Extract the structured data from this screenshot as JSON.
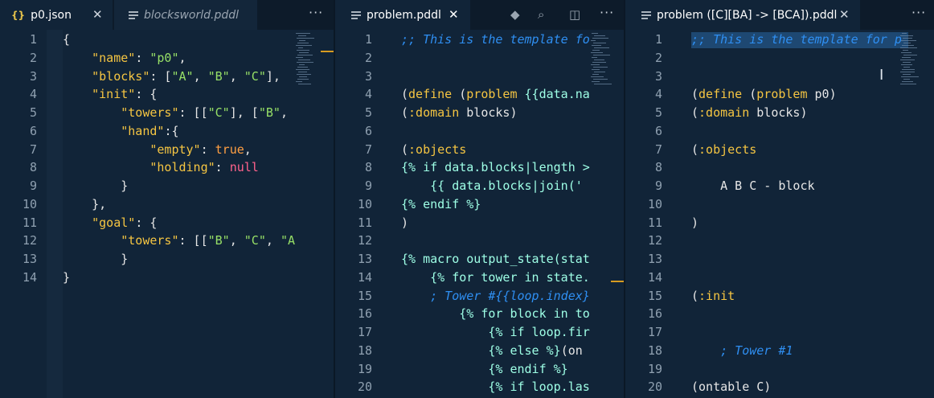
{
  "pane1": {
    "tabs": [
      {
        "label": "p0.json",
        "icon": "json-file-icon",
        "close": "✕"
      },
      {
        "label": "blocksworld.pddl",
        "icon": "lines-file-icon"
      }
    ],
    "more": "···",
    "lines": [
      {
        "n": "1",
        "segs": [
          {
            "t": "{",
            "c": "p"
          }
        ]
      },
      {
        "n": "2",
        "segs": [
          {
            "t": "    ",
            "c": "p"
          },
          {
            "t": "\"name\"",
            "c": "k"
          },
          {
            "t": ": ",
            "c": "p"
          },
          {
            "t": "\"p0\"",
            "c": "s"
          },
          {
            "t": ",",
            "c": "p"
          }
        ]
      },
      {
        "n": "3",
        "segs": [
          {
            "t": "    ",
            "c": "p"
          },
          {
            "t": "\"blocks\"",
            "c": "k"
          },
          {
            "t": ": [",
            "c": "p"
          },
          {
            "t": "\"A\"",
            "c": "s"
          },
          {
            "t": ", ",
            "c": "p"
          },
          {
            "t": "\"B\"",
            "c": "s"
          },
          {
            "t": ", ",
            "c": "p"
          },
          {
            "t": "\"C\"",
            "c": "s"
          },
          {
            "t": "],",
            "c": "p"
          }
        ]
      },
      {
        "n": "4",
        "segs": [
          {
            "t": "    ",
            "c": "p"
          },
          {
            "t": "\"init\"",
            "c": "k"
          },
          {
            "t": ": {",
            "c": "p"
          }
        ]
      },
      {
        "n": "5",
        "segs": [
          {
            "t": "        ",
            "c": "p"
          },
          {
            "t": "\"towers\"",
            "c": "k"
          },
          {
            "t": ": [[",
            "c": "p"
          },
          {
            "t": "\"C\"",
            "c": "s"
          },
          {
            "t": "], [",
            "c": "p"
          },
          {
            "t": "\"B\"",
            "c": "s"
          },
          {
            "t": ",",
            "c": "p"
          }
        ]
      },
      {
        "n": "6",
        "segs": [
          {
            "t": "        ",
            "c": "p"
          },
          {
            "t": "\"hand\"",
            "c": "k"
          },
          {
            "t": ":{",
            "c": "p"
          }
        ]
      },
      {
        "n": "7",
        "segs": [
          {
            "t": "            ",
            "c": "p"
          },
          {
            "t": "\"empty\"",
            "c": "k"
          },
          {
            "t": ": ",
            "c": "p"
          },
          {
            "t": "true",
            "c": "b"
          },
          {
            "t": ",",
            "c": "p"
          }
        ]
      },
      {
        "n": "8",
        "segs": [
          {
            "t": "            ",
            "c": "p"
          },
          {
            "t": "\"holding\"",
            "c": "k"
          },
          {
            "t": ": ",
            "c": "p"
          },
          {
            "t": "null",
            "c": "n"
          }
        ]
      },
      {
        "n": "9",
        "segs": [
          {
            "t": "        }",
            "c": "p"
          }
        ]
      },
      {
        "n": "10",
        "segs": [
          {
            "t": "    },",
            "c": "p"
          }
        ]
      },
      {
        "n": "11",
        "segs": [
          {
            "t": "    ",
            "c": "p"
          },
          {
            "t": "\"goal\"",
            "c": "k"
          },
          {
            "t": ": {",
            "c": "p"
          }
        ]
      },
      {
        "n": "12",
        "segs": [
          {
            "t": "        ",
            "c": "p"
          },
          {
            "t": "\"towers\"",
            "c": "k"
          },
          {
            "t": ": [[",
            "c": "p"
          },
          {
            "t": "\"B\"",
            "c": "s"
          },
          {
            "t": ", ",
            "c": "p"
          },
          {
            "t": "\"C\"",
            "c": "s"
          },
          {
            "t": ", ",
            "c": "p"
          },
          {
            "t": "\"A",
            "c": "s"
          }
        ]
      },
      {
        "n": "13",
        "segs": [
          {
            "t": "        }",
            "c": "p"
          }
        ]
      },
      {
        "n": "14",
        "segs": [
          {
            "t": "}",
            "c": "p"
          }
        ]
      }
    ]
  },
  "pane2": {
    "tabs": [
      {
        "label": "problem.pddl",
        "icon": "lines-file-icon",
        "close": "✕"
      }
    ],
    "toolbar": [
      {
        "name": "preview-diamond-icon",
        "glyph": "◆"
      },
      {
        "name": "search-preview-icon",
        "glyph": "⌕"
      },
      {
        "name": "split-editor-icon",
        "glyph": "◫"
      }
    ],
    "more": "···",
    "lines": [
      {
        "n": "1",
        "segs": [
          {
            "t": ";; This is the template fo",
            "c": "c"
          }
        ]
      },
      {
        "n": "2",
        "segs": []
      },
      {
        "n": "3",
        "segs": []
      },
      {
        "n": "4",
        "segs": [
          {
            "t": "(",
            "c": "p"
          },
          {
            "t": "define",
            "c": "k"
          },
          {
            "t": " (",
            "c": "p"
          },
          {
            "t": "problem",
            "c": "k"
          },
          {
            "t": " {{data.na",
            "c": "t"
          }
        ]
      },
      {
        "n": "5",
        "segs": [
          {
            "t": "(",
            "c": "p"
          },
          {
            "t": ":domain",
            "c": "k"
          },
          {
            "t": " blocks)",
            "c": "p"
          }
        ]
      },
      {
        "n": "6",
        "segs": []
      },
      {
        "n": "7",
        "segs": [
          {
            "t": "(",
            "c": "p"
          },
          {
            "t": ":objects",
            "c": "k"
          }
        ]
      },
      {
        "n": "8",
        "segs": [
          {
            "t": "{% if data.blocks|length >",
            "c": "t"
          }
        ]
      },
      {
        "n": "9",
        "segs": [
          {
            "t": "    {{ data.blocks|join('",
            "c": "t"
          }
        ]
      },
      {
        "n": "10",
        "segs": [
          {
            "t": "{% endif %}",
            "c": "t"
          }
        ]
      },
      {
        "n": "11",
        "segs": [
          {
            "t": ")",
            "c": "p"
          }
        ]
      },
      {
        "n": "12",
        "segs": []
      },
      {
        "n": "13",
        "segs": [
          {
            "t": "{% macro output_state(stat",
            "c": "t"
          }
        ]
      },
      {
        "n": "14",
        "segs": [
          {
            "t": "    {% for tower in state.",
            "c": "t"
          }
        ]
      },
      {
        "n": "15",
        "segs": [
          {
            "t": "    ; Tower #{{loop.index}",
            "c": "c"
          }
        ]
      },
      {
        "n": "16",
        "segs": [
          {
            "t": "        {% for block in to",
            "c": "t"
          }
        ]
      },
      {
        "n": "17",
        "segs": [
          {
            "t": "            {% if loop.fir",
            "c": "t"
          }
        ]
      },
      {
        "n": "18",
        "segs": [
          {
            "t": "            {% else %}",
            "c": "t"
          },
          {
            "t": "(on",
            "c": "p"
          }
        ]
      },
      {
        "n": "19",
        "segs": [
          {
            "t": "            {% endif %}",
            "c": "t"
          }
        ]
      },
      {
        "n": "20",
        "segs": [
          {
            "t": "            {% if loop.las",
            "c": "t"
          }
        ]
      }
    ]
  },
  "pane3": {
    "tabs": [
      {
        "label": "problem ([C][BA] -> [BCA]).pddl",
        "icon": "lines-file-icon",
        "close": "✕"
      }
    ],
    "more": "···",
    "lines": [
      {
        "n": "1",
        "segs": [
          {
            "t": ";; This is the template for p",
            "c": "c"
          }
        ]
      },
      {
        "n": "2",
        "segs": []
      },
      {
        "n": "3",
        "segs": []
      },
      {
        "n": "4",
        "segs": [
          {
            "t": "(",
            "c": "p"
          },
          {
            "t": "define",
            "c": "k"
          },
          {
            "t": " (",
            "c": "p"
          },
          {
            "t": "problem",
            "c": "k"
          },
          {
            "t": " p0)",
            "c": "p"
          }
        ]
      },
      {
        "n": "5",
        "segs": [
          {
            "t": "(",
            "c": "p"
          },
          {
            "t": ":domain",
            "c": "k"
          },
          {
            "t": " blocks)",
            "c": "p"
          }
        ]
      },
      {
        "n": "6",
        "segs": []
      },
      {
        "n": "7",
        "segs": [
          {
            "t": "(",
            "c": "p"
          },
          {
            "t": ":objects",
            "c": "k"
          }
        ]
      },
      {
        "n": "8",
        "segs": []
      },
      {
        "n": "9",
        "segs": [
          {
            "t": "    A B C - block",
            "c": "p"
          }
        ]
      },
      {
        "n": "10",
        "segs": []
      },
      {
        "n": "11",
        "segs": [
          {
            "t": ")",
            "c": "p"
          }
        ]
      },
      {
        "n": "12",
        "segs": []
      },
      {
        "n": "13",
        "segs": []
      },
      {
        "n": "14",
        "segs": []
      },
      {
        "n": "15",
        "segs": [
          {
            "t": "(",
            "c": "p"
          },
          {
            "t": ":init",
            "c": "k"
          }
        ]
      },
      {
        "n": "16",
        "segs": []
      },
      {
        "n": "17",
        "segs": []
      },
      {
        "n": "18",
        "segs": [
          {
            "t": "    ; Tower #1",
            "c": "c"
          }
        ]
      },
      {
        "n": "19",
        "segs": []
      },
      {
        "n": "20",
        "segs": [
          {
            "t": "(ontable C)",
            "c": "p"
          }
        ]
      }
    ]
  }
}
